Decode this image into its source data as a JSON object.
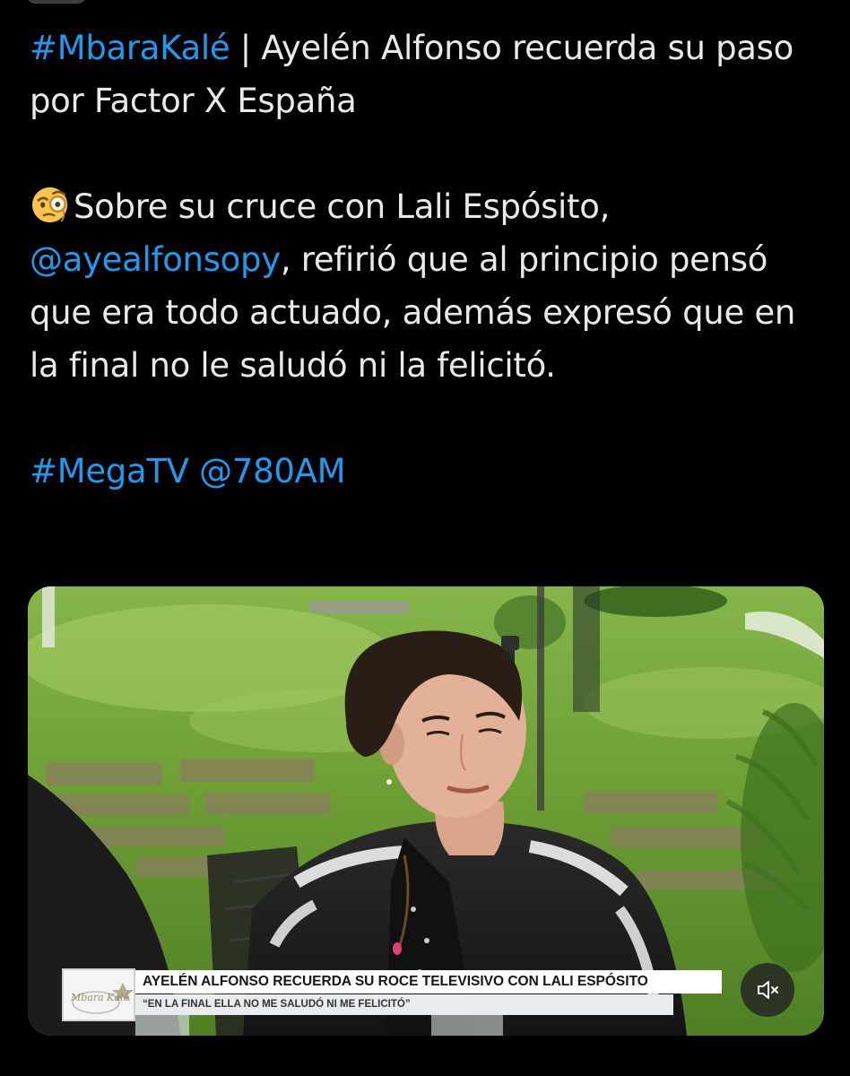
{
  "tweet": {
    "line1": {
      "hashtag": "#MbaraKalé",
      "text": " | Ayelén Alfonso recuerda su paso por Factor X España"
    },
    "line2": {
      "emoji": "face-with-monocle",
      "text_a": "Sobre su cruce con Lali Espósito, ",
      "mention": "@ayealfonsopy",
      "text_b": ", refirió que al principio pensó que era todo actuado, además expresó que en la final no le saludó ni la felicitó."
    },
    "line3": {
      "hashtag": "#MegaTV",
      "mention": "@780AM"
    }
  },
  "media": {
    "lower_third": {
      "logo_text": "Mbara Kalé",
      "headline": "AYELÉN ALFONSO RECUERDA SU ROCE TELEVISIVO CON LALI ESPÓSITO",
      "subtitle": "“EN LA FINAL ELLA NO ME SALUDÓ NI ME FELICITÓ”"
    },
    "mute_icon": "speaker-muted-icon"
  },
  "colors": {
    "background": "#000000",
    "text": "#e7e9ea",
    "link": "#1d9bf0"
  }
}
